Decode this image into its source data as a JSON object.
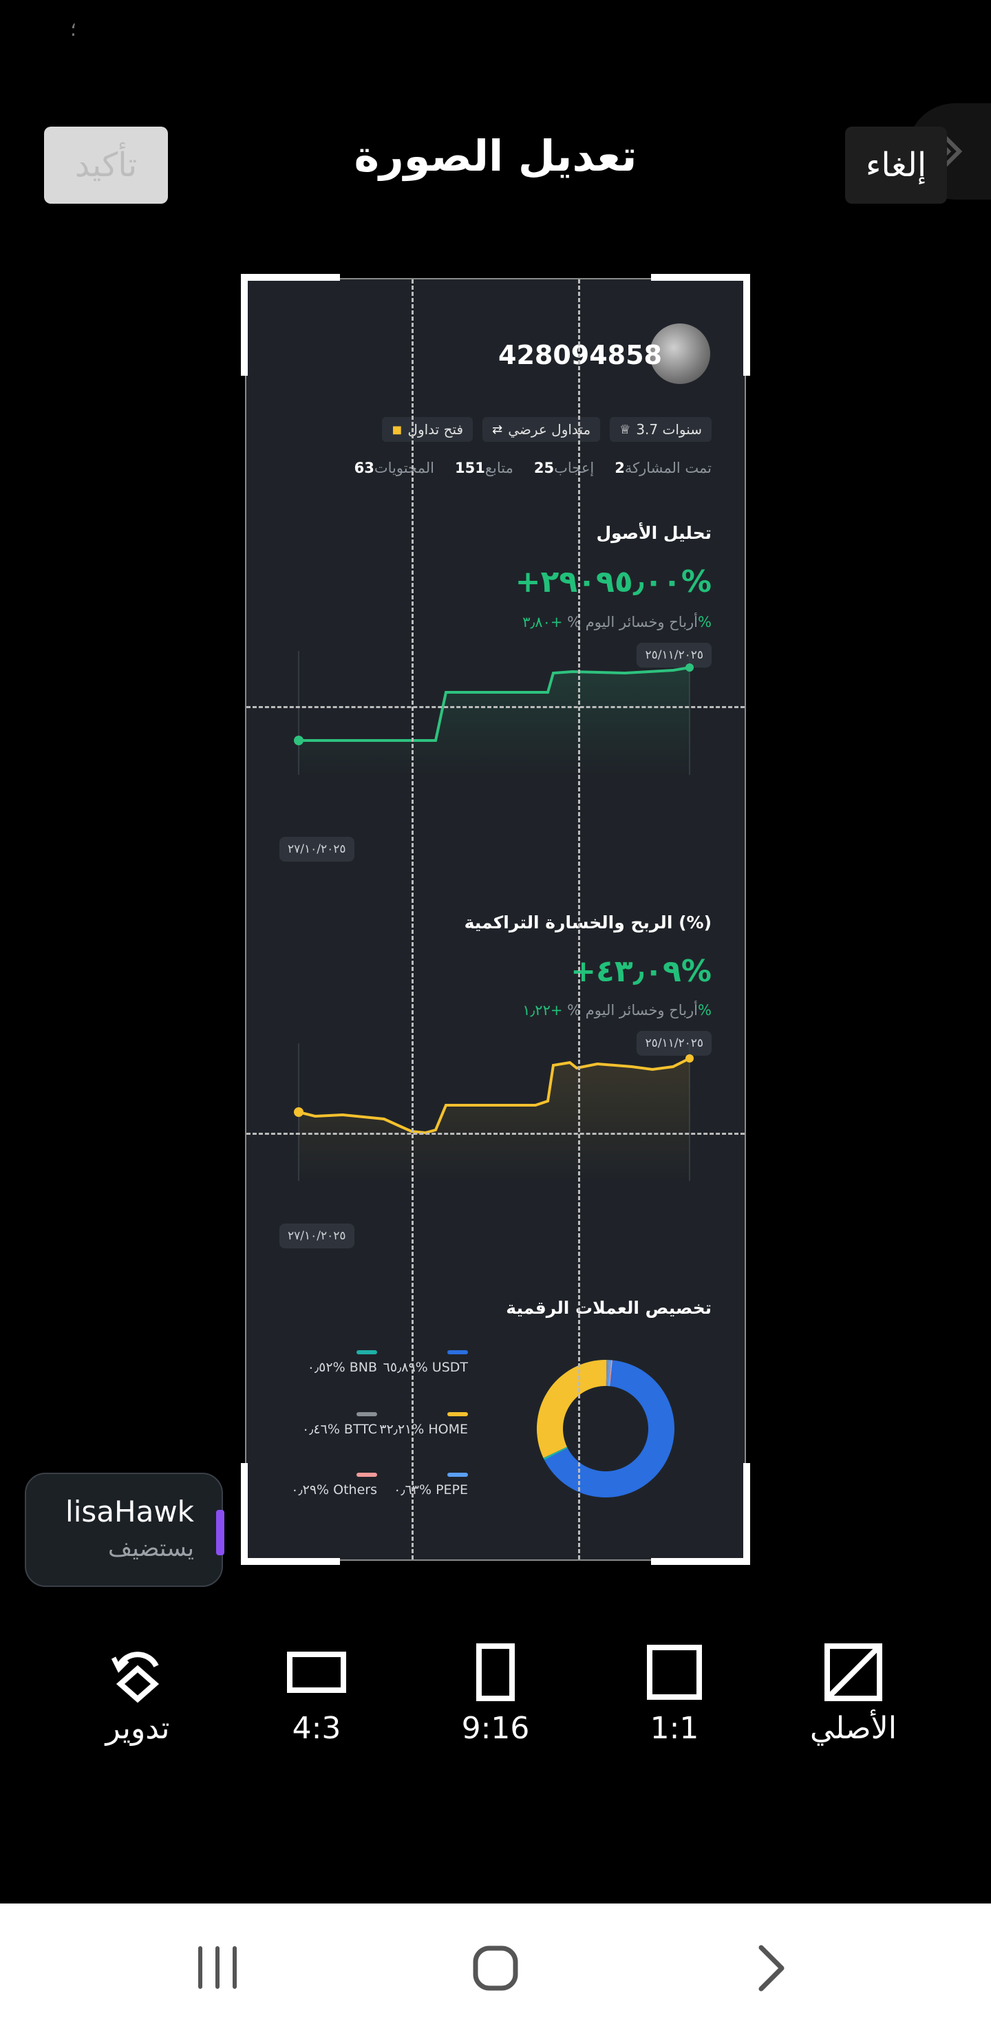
{
  "header": {
    "title": "تعديل الصورة",
    "confirm_label": "تأكيد",
    "cancel_label": "إلغاء"
  },
  "status_bar": {
    "glyph": "؛"
  },
  "profile": {
    "user_id": "428094858",
    "tags": [
      {
        "icon": "trophy-icon",
        "label": "3.7 سنوات"
      },
      {
        "icon": "swap-icon",
        "label": "متداول عرضي"
      },
      {
        "icon": "bolt-icon",
        "label": "فتح تداول"
      }
    ],
    "stats": [
      {
        "value": "2",
        "label": "تمت المشاركة"
      },
      {
        "value": "25",
        "label": "إعجاب"
      },
      {
        "value": "151",
        "label": "متابع"
      },
      {
        "value": "63",
        "label": "المحتويات"
      }
    ]
  },
  "asset_section": {
    "title": "تحليل الأصول",
    "value": "+٢٩٠٩٥٫٠٠%",
    "today_label": "أرباح وخسائر اليوم %",
    "today_value": "+٣٫٨٠%",
    "end_date": "٢٥/١١/٢٠٢٥",
    "start_date": "٢٧/١٠/٢٠٢٥",
    "line_color": "#2ec27e"
  },
  "pnl_section": {
    "title": "الربح والخسارة التراكمية (%)",
    "value": "+٤٣٫٠٩%",
    "today_label": "أرباح وخسائر اليوم %",
    "today_value": "+١٫٢٢%",
    "end_date": "٢٥/١١/٢٠٢٥",
    "start_date": "٢٧/١٠/٢٠٢٥",
    "line_color": "#f5c12e"
  },
  "allocation": {
    "title": "تخصيص العملات الرقمية",
    "items": [
      {
        "name": "USDT",
        "pct": "٦٥٫٨٩%",
        "value": 65.89,
        "color": "#2a6ee0"
      },
      {
        "name": "BNB",
        "pct": "٠٫٥٢%",
        "value": 0.52,
        "color": "#1fb0a8"
      },
      {
        "name": "HOME",
        "pct": "٣٢٫٢١%",
        "value": 32.21,
        "color": "#f5c12e"
      },
      {
        "name": "BTTC",
        "pct": "٠٫٤٦%",
        "value": 0.46,
        "color": "#8a8f96"
      },
      {
        "name": "PEPE",
        "pct": "٠٫٦٣%",
        "value": 0.63,
        "color": "#5aa0f5"
      },
      {
        "name": "Others",
        "pct": "٠٫٢٩%",
        "value": 0.29,
        "color": "#f39a9a"
      }
    ]
  },
  "watermark": {
    "name": "lisaHawk",
    "sub": "يستضيف"
  },
  "tools": [
    {
      "name": "rotate",
      "label": "تدوير",
      "icon": "rotate-icon"
    },
    {
      "name": "ratio-4-3",
      "label": "4:3",
      "icon": "ratio-4-3-icon"
    },
    {
      "name": "ratio-9-16",
      "label": "9:16",
      "icon": "ratio-9-16-icon"
    },
    {
      "name": "ratio-1-1",
      "label": "1:1",
      "icon": "ratio-1-1-icon"
    },
    {
      "name": "original",
      "label": "الأصلي",
      "icon": "original-ratio-icon"
    }
  ],
  "nav": [
    "recent-apps-icon",
    "home-icon",
    "back-icon"
  ]
}
